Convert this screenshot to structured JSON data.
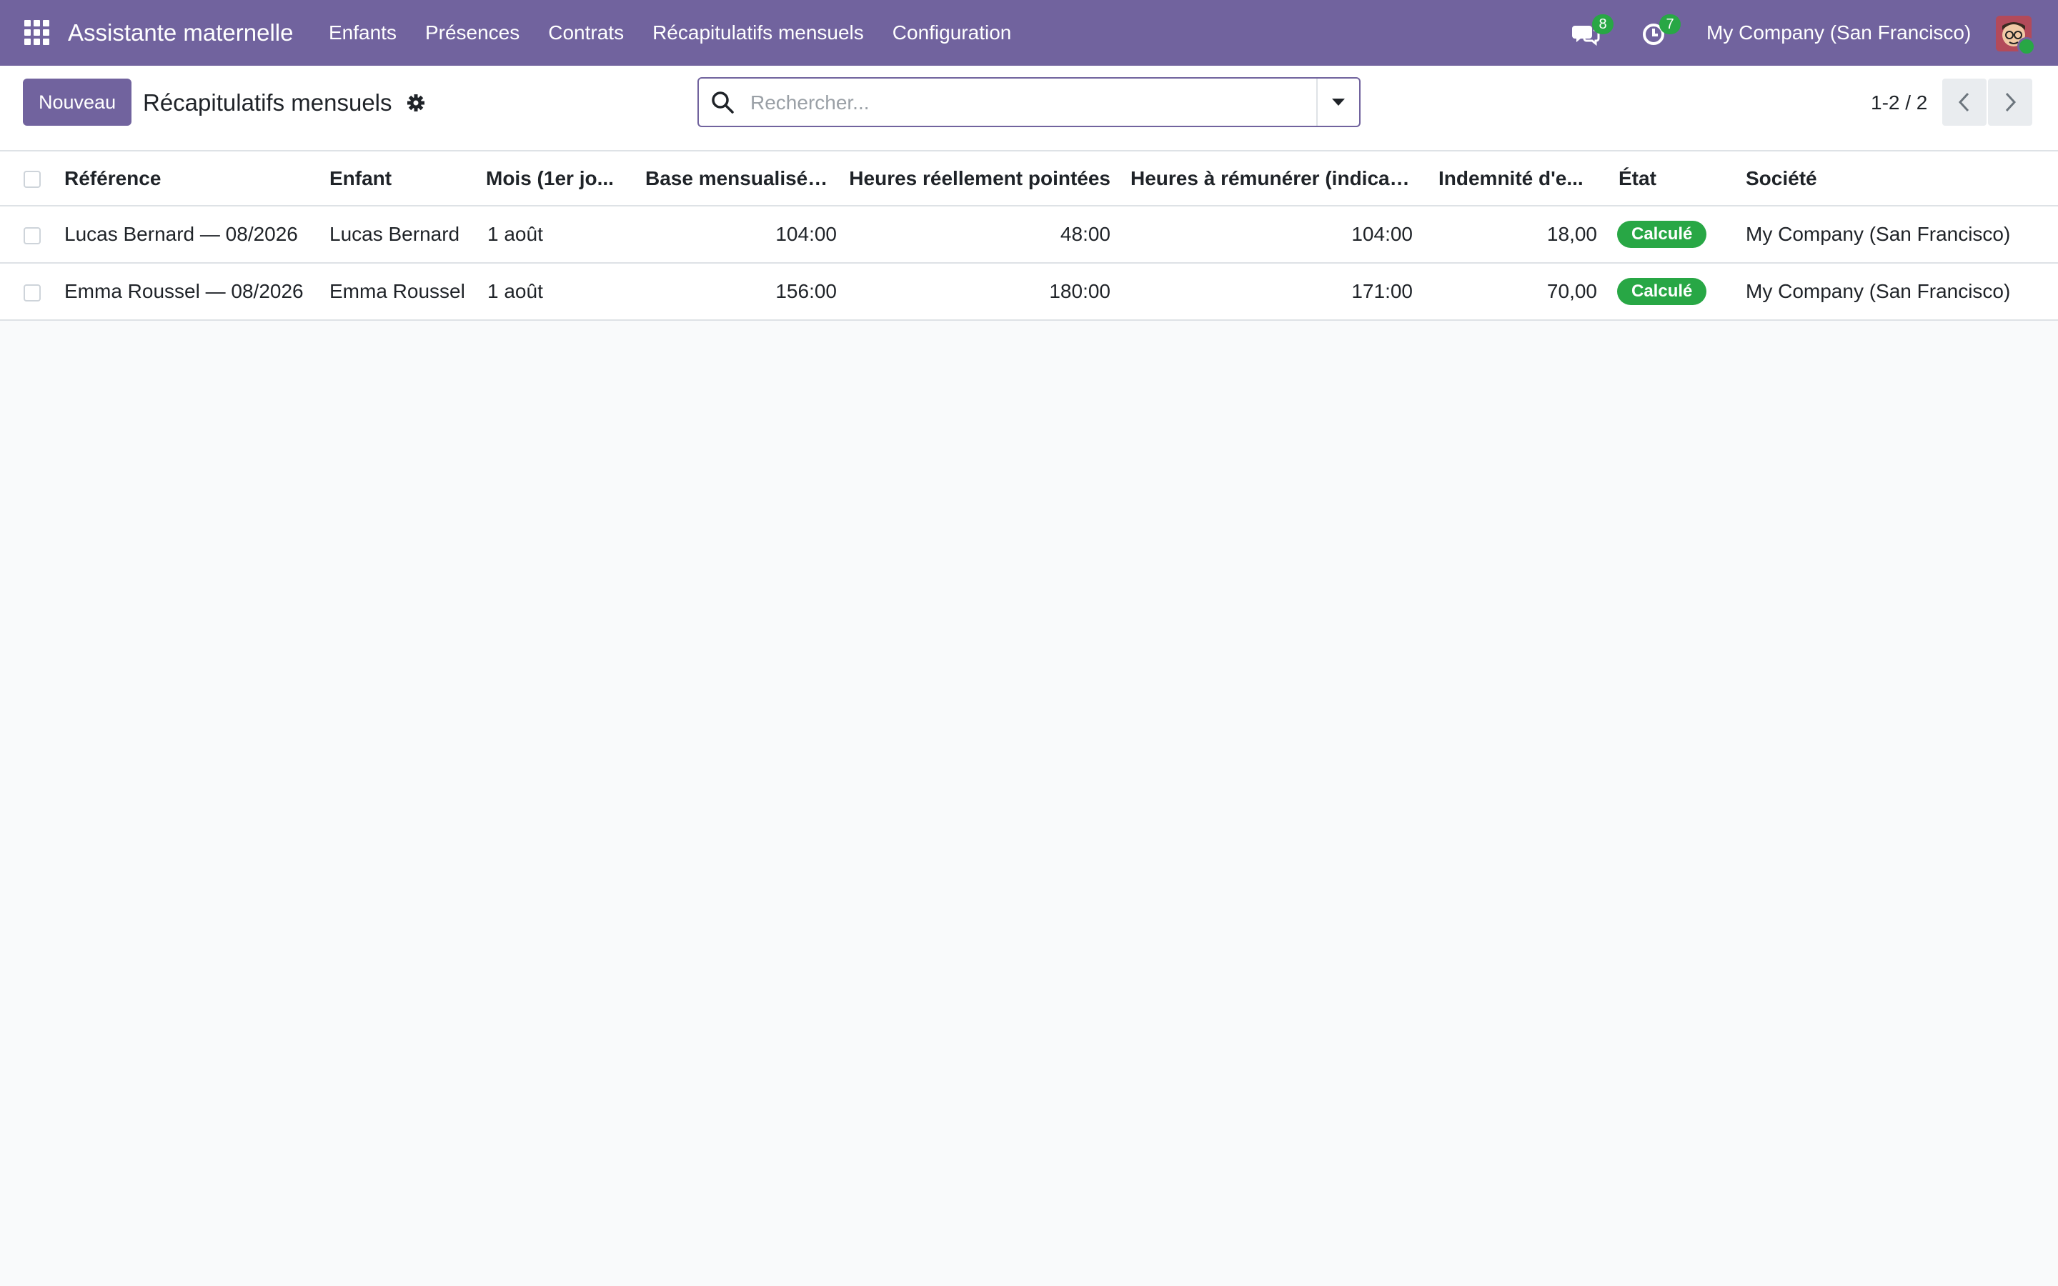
{
  "navbar": {
    "app_name": "Assistante maternelle",
    "menu": [
      "Enfants",
      "Présences",
      "Contrats",
      "Récapitulatifs mensuels",
      "Configuration"
    ],
    "messages_count": "8",
    "activities_count": "7",
    "company": "My Company (San Francisco)",
    "accent_color": "#71639e"
  },
  "control": {
    "new_label": "Nouveau",
    "title": "Récapitulatifs mensuels",
    "search_placeholder": "Rechercher...",
    "pager": "1-2 / 2"
  },
  "table": {
    "columns": [
      "Référence",
      "Enfant",
      "Mois (1er jo...",
      "Base mensualisée (h)",
      "Heures réellement pointées",
      "Heures à rémunérer (indicatif)",
      "Indemnité d'e...",
      "État",
      "Société"
    ],
    "rows": [
      {
        "reference": "Lucas Bernard — 08/2026",
        "child": "Lucas Bernard",
        "month": "1 août",
        "base_hours": "104:00",
        "actual_hours": "48:00",
        "paid_hours": "104:00",
        "allowance": "18,00",
        "state": "Calculé",
        "company": "My Company (San Francisco)"
      },
      {
        "reference": "Emma Roussel — 08/2026",
        "child": "Emma Roussel",
        "month": "1 août",
        "base_hours": "156:00",
        "actual_hours": "180:00",
        "paid_hours": "171:00",
        "allowance": "70,00",
        "state": "Calculé",
        "company": "My Company (San Francisco)"
      }
    ]
  }
}
